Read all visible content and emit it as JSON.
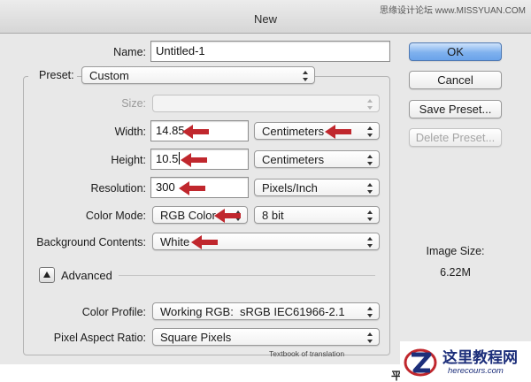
{
  "window": {
    "title": "New",
    "top_watermark": "思缘设计论坛 www.MISSYUAN.COM"
  },
  "form": {
    "name_label": "Name:",
    "name_value": "Untitled-1",
    "preset_label": "Preset:",
    "preset_value": "Custom",
    "size_label": "Size:",
    "size_value": "",
    "width_label": "Width:",
    "width_value": "14.85",
    "width_unit": "Centimeters",
    "height_label": "Height:",
    "height_value": "10.5",
    "height_unit": "Centimeters",
    "resolution_label": "Resolution:",
    "resolution_value": "300",
    "resolution_unit": "Pixels/Inch",
    "color_mode_label": "Color Mode:",
    "color_mode_value": "RGB Color",
    "bit_depth_value": "8 bit",
    "background_label": "Background Contents:",
    "background_value": "White",
    "advanced_label": "Advanced",
    "color_profile_label": "Color Profile:",
    "color_profile_value": "Working RGB:  sRGB IEC61966-2.1",
    "pixel_aspect_label": "Pixel Aspect Ratio:",
    "pixel_aspect_value": "Square Pixels"
  },
  "buttons": {
    "ok": "OK",
    "cancel": "Cancel",
    "save_preset": "Save Preset...",
    "delete_preset": "Delete Preset..."
  },
  "image_size": {
    "label": "Image Size:",
    "value": "6.22M"
  },
  "watermark": {
    "caption": "Textbook of translation",
    "logo_title": "这里教程网",
    "logo_url": "herecours.com",
    "stray_char": "平"
  },
  "colors": {
    "arrow": "#c0272d",
    "primary_button": "#6aa3ea",
    "logo": "#1c2e7a"
  }
}
